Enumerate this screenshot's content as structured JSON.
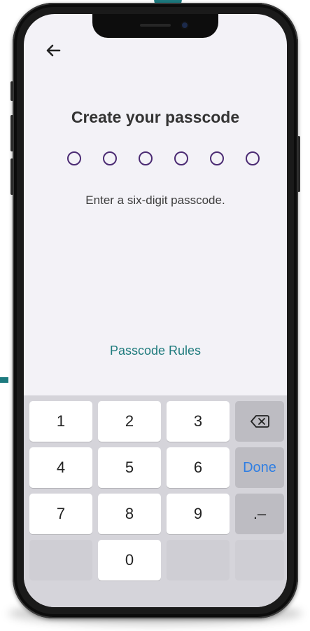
{
  "screen": {
    "title": "Create your passcode",
    "instruction": "Enter a six-digit passcode.",
    "rules_link": "Passcode Rules",
    "passcode_slots": 6,
    "passcode_filled": 0
  },
  "keyboard": {
    "keys": [
      "1",
      "2",
      "3",
      "4",
      "5",
      "6",
      "7",
      "8",
      "9",
      "0"
    ],
    "done_label": "Done",
    "punct_label": ".–"
  },
  "colors": {
    "accent_teal": "#1f7b7d",
    "dot_border": "#4b2b73",
    "done_blue": "#2f7ee3"
  }
}
